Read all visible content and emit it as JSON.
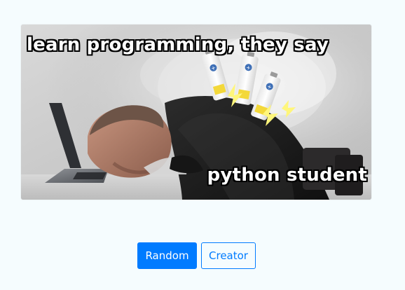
{
  "meme": {
    "top_text": "learn programming, they say",
    "bottom_text": "python student"
  },
  "buttons": {
    "random_label": "Random",
    "creator_label": "Creator"
  },
  "colors": {
    "background": "#f5fcfe",
    "primary": "#007bff",
    "caption_text": "#ffffff",
    "caption_outline": "#000000"
  }
}
